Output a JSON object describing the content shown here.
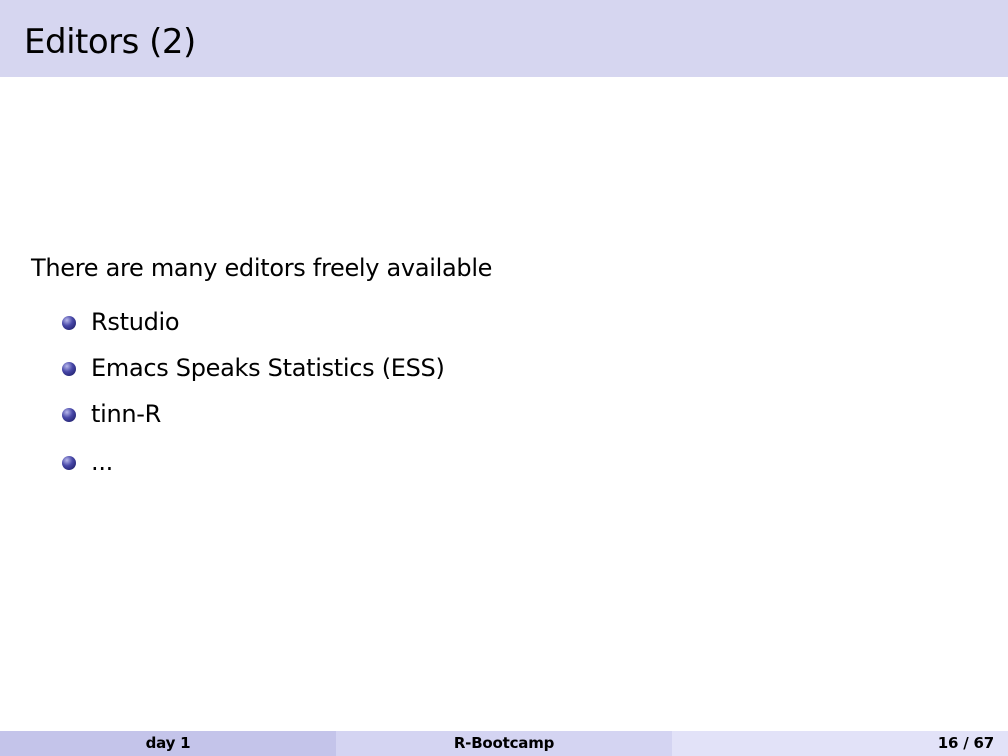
{
  "slide": {
    "title": "Editors (2)",
    "intro": "There are many editors freely available",
    "items": [
      {
        "label": "Rstudio"
      },
      {
        "label": "Emacs Speaks Statistics (ESS)"
      },
      {
        "label": "tinn-R"
      },
      {
        "label": "..."
      }
    ]
  },
  "footer": {
    "left": "day 1",
    "center": "R-Bootcamp",
    "page": "16 / 67"
  },
  "colors": {
    "title_bar": "#d6d6f0",
    "bullet": "#2a2a80",
    "footer_left": "#c4c4ea",
    "footer_center": "#d4d4f2",
    "footer_right": "#e2e2f8"
  }
}
